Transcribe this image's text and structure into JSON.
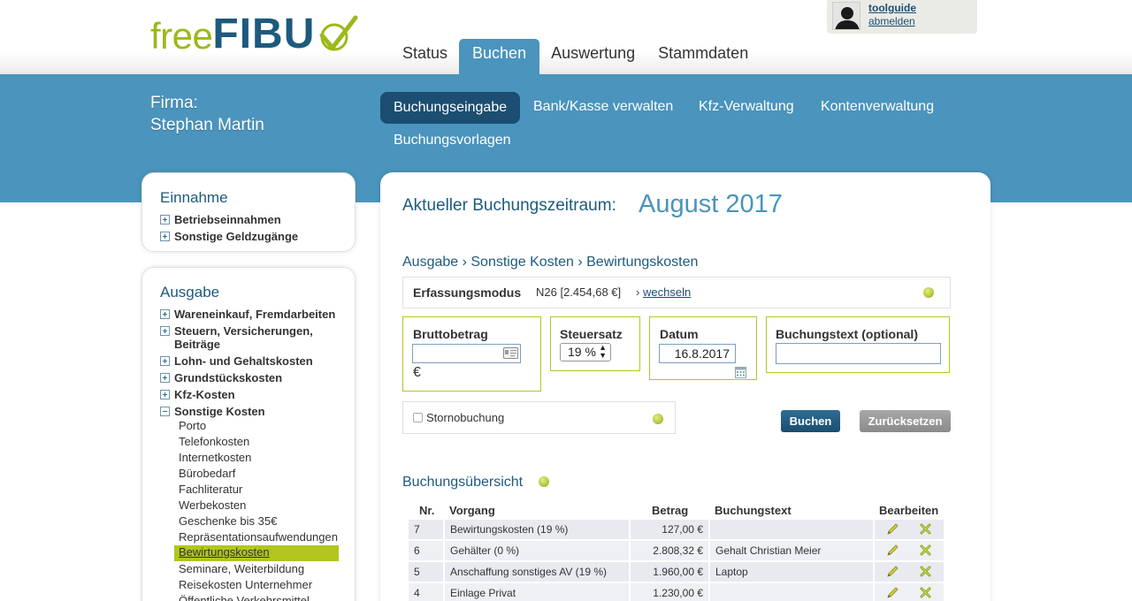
{
  "logo": {
    "free": "free",
    "fibu": "FIBU"
  },
  "user": {
    "name": "toolguide",
    "logout": "abmelden"
  },
  "main_tabs": [
    {
      "label": "Status"
    },
    {
      "label": "Buchen"
    },
    {
      "label": "Auswertung"
    },
    {
      "label": "Stammdaten"
    }
  ],
  "company": {
    "label": "Firma:",
    "name": "Stephan Martin"
  },
  "sub_tabs": [
    {
      "label": "Buchungseingabe"
    },
    {
      "label": "Bank/Kasse verwalten"
    },
    {
      "label": "Kfz-Verwaltung"
    },
    {
      "label": "Kontenverwaltung"
    },
    {
      "label": "Buchungsvorlagen"
    }
  ],
  "sidebar": {
    "income": {
      "title": "Einnahme",
      "items": [
        {
          "label": "Betriebseinnahmen"
        },
        {
          "label": "Sonstige Geldzugänge"
        }
      ]
    },
    "expense": {
      "title": "Ausgabe",
      "items": [
        {
          "label": "Wareneinkauf, Fremdarbeiten"
        },
        {
          "label": "Steuern, Versicherungen, Beiträge"
        },
        {
          "label": "Lohn- und Gehaltskosten"
        },
        {
          "label": "Grundstückskosten"
        },
        {
          "label": "Kfz-Kosten"
        },
        {
          "label": "Sonstige Kosten"
        }
      ],
      "subitems": [
        {
          "label": "Porto"
        },
        {
          "label": "Telefonkosten"
        },
        {
          "label": "Internetkosten"
        },
        {
          "label": "Bürobedarf"
        },
        {
          "label": "Fachliteratur"
        },
        {
          "label": "Werbekosten"
        },
        {
          "label": "Geschenke bis 35€"
        },
        {
          "label": "Repräsentationsaufwendungen"
        },
        {
          "label": "Bewirtungskosten"
        },
        {
          "label": "Seminare, Weiterbildung"
        },
        {
          "label": "Reisekosten Unternehmer"
        },
        {
          "label": "Öffentliche Verkehrsmittel"
        }
      ]
    }
  },
  "period": {
    "label": "Aktueller Buchungszeitraum:",
    "value": "August 2017"
  },
  "breadcrumb": "Ausgabe › Sonstige Kosten › Bewirtungskosten",
  "mode": {
    "label": "Erfassungsmodus",
    "account": "N26 [2.454,68 €]",
    "change_prefix": "›",
    "change": "wechseln"
  },
  "form": {
    "gross_label": "Bruttobetrag",
    "gross_value": "",
    "currency": "€",
    "tax_label": "Steuersatz",
    "tax_value": "19 %",
    "date_label": "Datum",
    "date_value": "16.8.2017",
    "text_label": "Buchungstext (optional)",
    "text_value": "",
    "storno_label": "Stornobuchung",
    "book_button": "Buchen",
    "reset_button": "Zurücksetzen"
  },
  "overview": {
    "title": "Buchungsübersicht",
    "columns": [
      "Nr.",
      "Vorgang",
      "Betrag",
      "Buchungstext",
      "Bearbeiten"
    ],
    "rows": [
      {
        "nr": "7",
        "vorgang": "Bewirtungskosten (19 %)",
        "betrag": "127,00 €",
        "text": ""
      },
      {
        "nr": "6",
        "vorgang": "Gehälter (0 %)",
        "betrag": "2.808,32 €",
        "text": "Gehalt Christian Meier"
      },
      {
        "nr": "5",
        "vorgang": "Anschaffung sonstiges AV (19 %)",
        "betrag": "1.960,00 €",
        "text": "Laptop"
      },
      {
        "nr": "4",
        "vorgang": "Einlage Privat",
        "betrag": "1.230,00 €",
        "text": ""
      }
    ]
  },
  "colors": {
    "brand_blue": "#4a94bd",
    "dark_blue": "#1b4e70",
    "lime": "#b2c61e"
  },
  "icons": [
    "checkmark-logo-icon",
    "user-avatar-icon",
    "help-icon",
    "id-card-icon",
    "calendar-icon",
    "edit-pencil-icon",
    "delete-icon"
  ]
}
